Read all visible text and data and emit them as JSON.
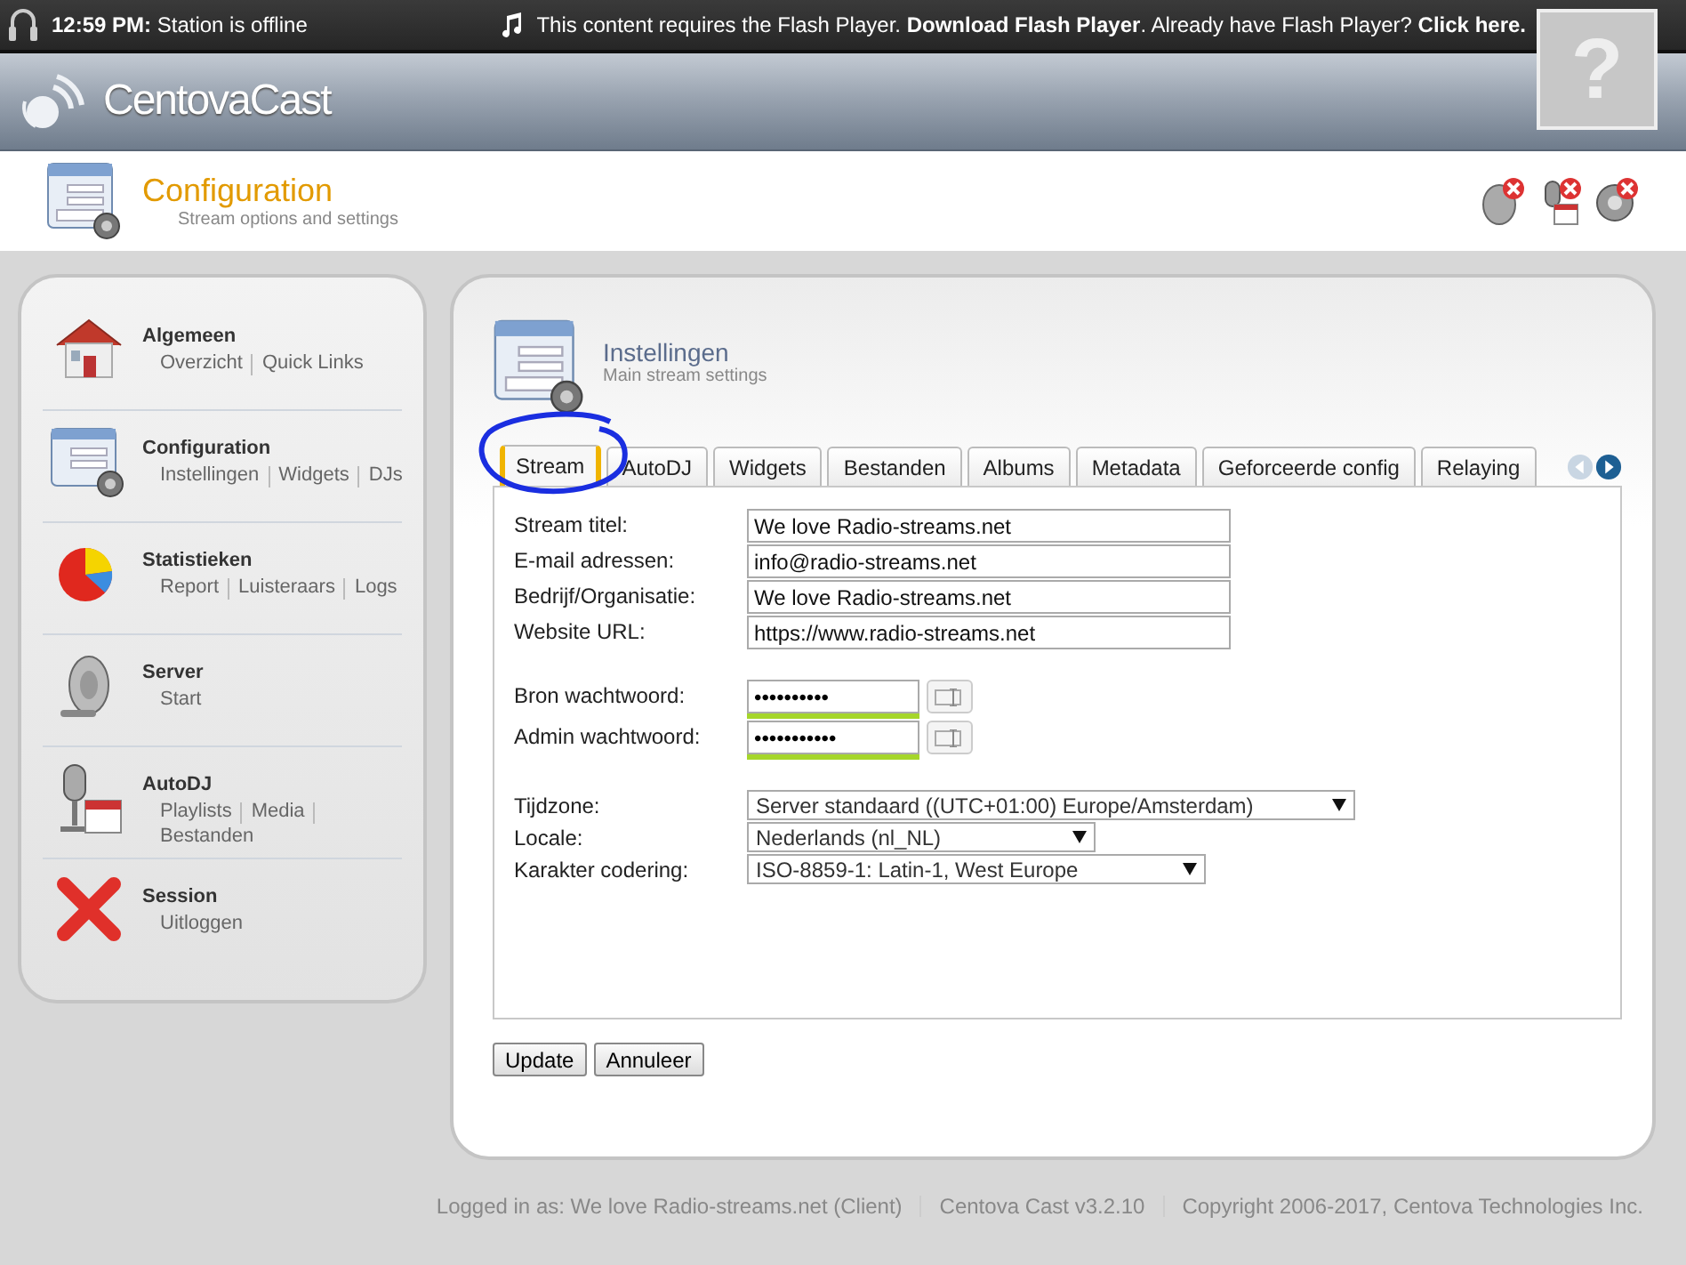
{
  "status_bar": {
    "time": "12:59 PM:",
    "status": "Station is offline",
    "flash_notice": [
      {
        "text": "This content requires the Flash Player. ",
        "link": false
      },
      {
        "text": "Download Flash Player",
        "link": true
      },
      {
        "text": ". Already have Flash Player? ",
        "link": false
      },
      {
        "text": "Click here.",
        "link": true
      }
    ],
    "plugin_glyph": "?"
  },
  "brand": {
    "name": "CentovaCast"
  },
  "page_header": {
    "title": "Configuration",
    "subtitle": "Stream options and settings"
  },
  "sidebar": {
    "sections": [
      {
        "kind": "house",
        "title": "Algemeen",
        "links": [
          "Overzicht",
          "Quick Links"
        ]
      },
      {
        "kind": "form",
        "title": "Configuration",
        "links": [
          "Instellingen",
          "Widgets",
          "DJs"
        ]
      },
      {
        "kind": "pie",
        "title": "Statistieken",
        "links": [
          "Report",
          "Luisteraars",
          "Logs"
        ]
      },
      {
        "kind": "speaker",
        "title": "Server",
        "links": [
          "Start"
        ]
      },
      {
        "kind": "mic",
        "title": "AutoDJ",
        "links": [
          "Playlists",
          "Media",
          "Bestanden"
        ]
      },
      {
        "kind": "cross",
        "title": "Session",
        "links": [
          "Uitloggen"
        ]
      }
    ]
  },
  "panel": {
    "title": "Instellingen",
    "subtitle": "Main stream settings",
    "tabs": [
      {
        "label": "Stream",
        "selected": true
      },
      {
        "label": "AutoDJ",
        "selected": false
      },
      {
        "label": "Widgets",
        "selected": false
      },
      {
        "label": "Bestanden",
        "selected": false
      },
      {
        "label": "Albums",
        "selected": false
      },
      {
        "label": "Metadata",
        "selected": false
      },
      {
        "label": "Geforceerde config",
        "selected": false
      },
      {
        "label": "Relaying",
        "selected": false
      }
    ],
    "tab_scroll": {
      "previous_disabled": true,
      "next_disabled": false
    },
    "groups": [
      [
        {
          "kind": "text",
          "label": "Stream titel:",
          "value": "We love Radio-streams.net"
        },
        {
          "kind": "text",
          "label": "E-mail adressen:",
          "value": "info@radio-streams.net"
        },
        {
          "kind": "text",
          "label": "Bedrijf/Organisatie:",
          "value": "We love Radio-streams.net"
        },
        {
          "kind": "text",
          "label": "Website URL:",
          "value": "https://www.radio-streams.net"
        }
      ],
      [
        {
          "kind": "password",
          "label": "Bron wachtwoord:",
          "value": "••••••••••",
          "level": 1
        },
        {
          "kind": "password",
          "label": "Admin wachtwoord:",
          "value": "•••••••••••",
          "level": 1
        }
      ],
      [
        {
          "kind": "select",
          "label": "Tijdzone:",
          "value": "Server standaard ((UTC+01:00) Europe/Amsterdam)"
        },
        {
          "kind": "select",
          "label": "Locale:",
          "value": "Nederlands (nl_NL)"
        },
        {
          "kind": "select",
          "label": "Karakter codering:",
          "value": "ISO-8859-1: Latin-1, West Europe"
        }
      ]
    ],
    "buttons": [
      "Update",
      "Annuleer"
    ]
  },
  "footer": [
    "Logged in as: We love Radio-streams.net (Client)",
    "Centova Cast v3.2.10",
    "Copyright 2006-2017, Centova Technologies Inc."
  ]
}
